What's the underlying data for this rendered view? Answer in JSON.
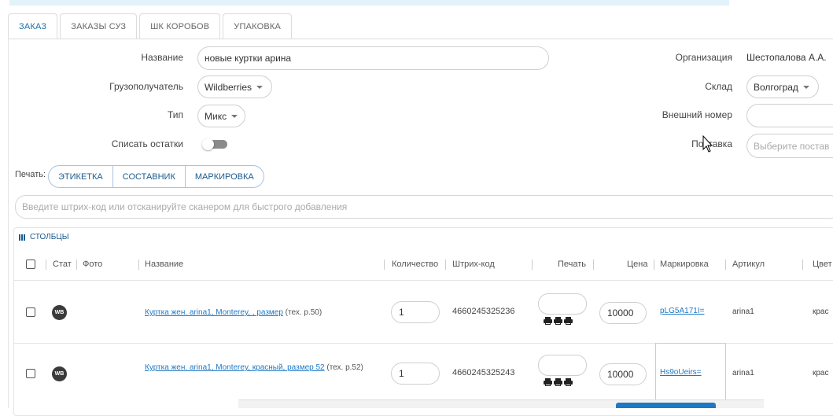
{
  "tabs": [
    {
      "label": "ЗАКАЗ",
      "active": true
    },
    {
      "label": "ЗАКАЗЫ СУЗ",
      "active": false
    },
    {
      "label": "ШК КОРОБОВ",
      "active": false
    },
    {
      "label": "УПАКОВКА",
      "active": false
    }
  ],
  "form": {
    "name_label": "Название",
    "name_value": "новые куртки арина",
    "consignee_label": "Грузополучатель",
    "consignee_value": "Wildberries",
    "type_label": "Тип",
    "type_value": "Микс",
    "writeoff_label": "Списать остатки",
    "writeoff_on": false,
    "org_label": "Организация",
    "org_value": "Шестопалова А.А.",
    "warehouse_label": "Склад",
    "warehouse_value": "Волгоград",
    "external_label": "Внешний номер",
    "external_value": "",
    "supply_label": "Поставка",
    "supply_placeholder": "Выберите постав"
  },
  "print": {
    "label": "Печать:",
    "buttons": [
      "ЭТИКЕТКА",
      "СОСТАВНИК",
      "МАРКИРОВКА"
    ]
  },
  "scan": {
    "placeholder": "Введите штрих-код или отсканируйте сканером для быстрого добавления"
  },
  "table": {
    "columns_label": "СТОЛБЦЫ",
    "headers": {
      "stat": "Стат",
      "photo": "Фото",
      "name": "Название",
      "qty": "Количество",
      "barcode": "Штрих-код",
      "print": "Печать",
      "price": "Цена",
      "marking": "Маркировка",
      "article": "Артикул",
      "color": "Цвет"
    },
    "rows": [
      {
        "badge": "WB",
        "name_link": "Куртка жен. arina1, Monterey, , размер",
        "name_suffix": " (тех. р.50)",
        "qty": "1",
        "barcode": "4660245325236",
        "price": "10000",
        "marking": "pLG5A171I=",
        "article": "arina1",
        "color": "крас"
      },
      {
        "badge": "WB",
        "name_link": "Куртка жен. arina1, Monterey, красный, размер 52",
        "name_suffix": " (тех. р.52)",
        "qty": "1",
        "barcode": "4660245325243",
        "price": "10000",
        "marking": "Hs9oUeirs=",
        "article": "arina1",
        "color": "крас"
      }
    ]
  }
}
